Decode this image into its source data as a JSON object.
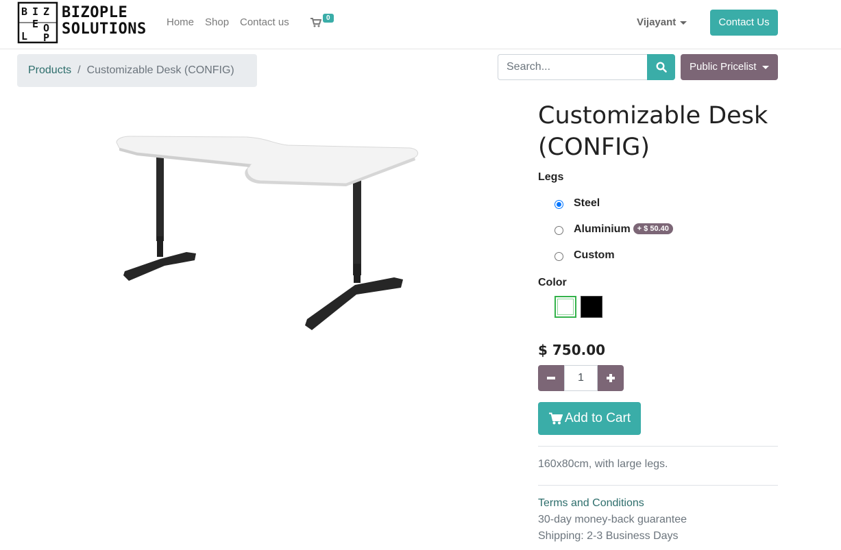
{
  "brand": {
    "line1": "BIZOPLE",
    "line2": "SOLUTIONS",
    "logo_letters": [
      "B",
      "I",
      "Z",
      "E",
      "O",
      "L",
      "P"
    ]
  },
  "nav": {
    "home": "Home",
    "shop": "Shop",
    "contact": "Contact us"
  },
  "cart": {
    "count": "0"
  },
  "user": {
    "name": "Vijayant"
  },
  "header": {
    "contact_button": "Contact Us"
  },
  "breadcrumb": {
    "parent": "Products",
    "separator": "/",
    "current": "Customizable Desk (CONFIG)"
  },
  "search": {
    "placeholder": "Search..."
  },
  "pricelist": {
    "label": "Public Pricelist"
  },
  "product": {
    "title": "Customizable Desk (CONFIG)",
    "legs_label": "Legs",
    "legs_options": [
      {
        "label": "Steel",
        "selected": true
      },
      {
        "label": "Aluminium",
        "extra": "+ $ 50.40",
        "selected": false
      },
      {
        "label": "Custom",
        "selected": false
      }
    ],
    "color_label": "Color",
    "colors": [
      {
        "value": "#ffffff",
        "selected": true
      },
      {
        "value": "#000000",
        "selected": false
      }
    ],
    "price": "$ 750.00",
    "quantity": "1",
    "add_to_cart": "Add to Cart",
    "description": "160x80cm, with large legs.",
    "terms": "Terms and Conditions",
    "guarantee": "30-day money-back guarantee",
    "shipping": "Shipping: 2-3 Business Days"
  },
  "colors": {
    "accent": "#3aada8",
    "secondary": "#7c6676",
    "link": "#2e6e6c"
  }
}
